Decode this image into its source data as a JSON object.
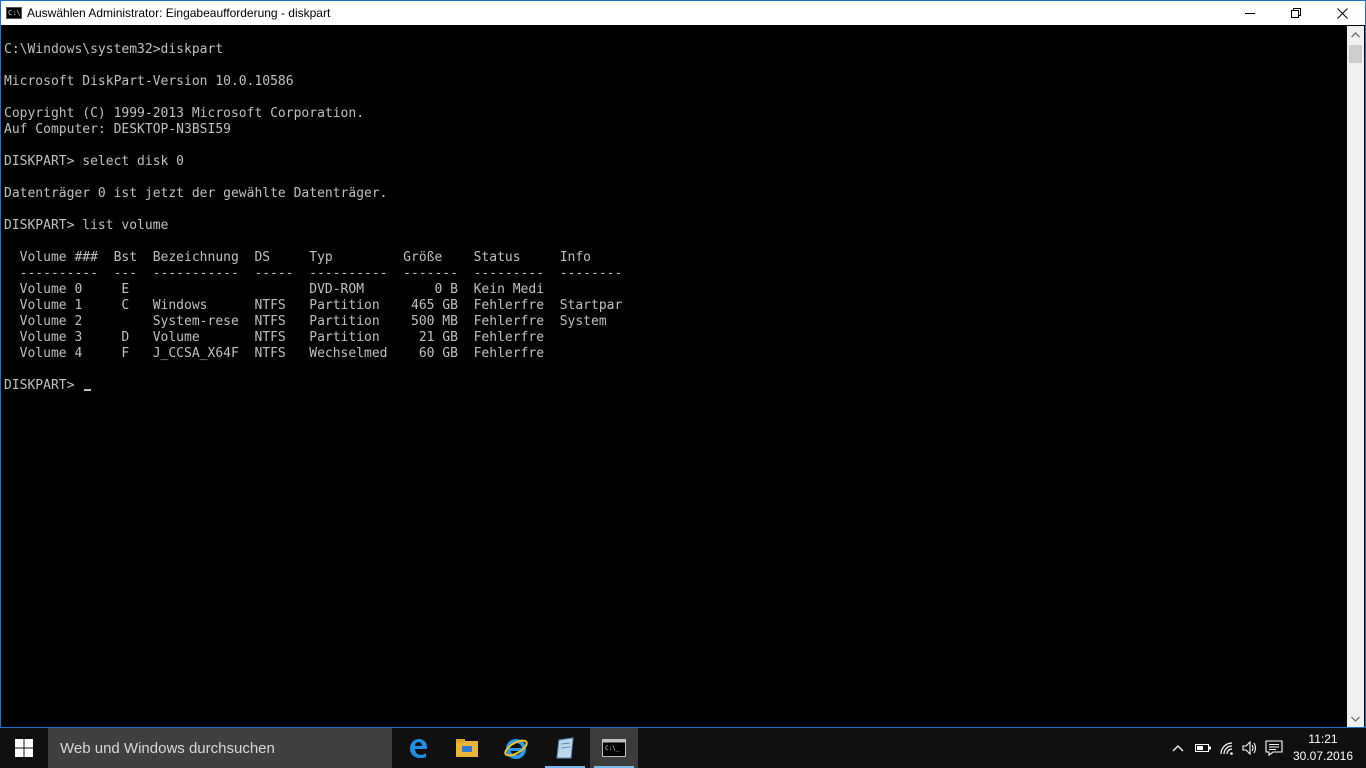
{
  "window": {
    "title": "Auswählen Administrator: Eingabeaufforderung - diskpart"
  },
  "console": {
    "lines": [
      "C:\\Windows\\system32>diskpart",
      "",
      "Microsoft DiskPart-Version 10.0.10586",
      "",
      "Copyright (C) 1999-2013 Microsoft Corporation.",
      "Auf Computer: DESKTOP-N3BSI59",
      "",
      "DISKPART> select disk 0",
      "",
      "Datenträger 0 ist jetzt der gewählte Datenträger.",
      "",
      "DISKPART> list volume",
      "",
      "  Volume ###  Bst  Bezeichnung  DS     Typ         Größe    Status     Info",
      "  ----------  ---  -----------  -----  ----------  -------  ---------  --------",
      "  Volume 0     E                       DVD-ROM         0 B  Kein Medi",
      "  Volume 1     C   Windows      NTFS   Partition    465 GB  Fehlerfre  Startpar",
      "  Volume 2         System-rese  NTFS   Partition    500 MB  Fehlerfre  System",
      "  Volume 3     D   Volume       NTFS   Partition     21 GB  Fehlerfre",
      "  Volume 4     F   J_CCSA_X64F  NTFS   Wechselmed    60 GB  Fehlerfre",
      "",
      "DISKPART> "
    ]
  },
  "taskbar": {
    "search_placeholder": "Web und Windows durchsuchen",
    "apps": [
      "edge-icon",
      "file-explorer-icon",
      "internet-explorer-icon",
      "notepad-icon",
      "command-prompt-icon"
    ],
    "clock_time": "11:21",
    "clock_date": "30.07.2016"
  },
  "colors": {
    "console_bg": "#000000",
    "console_text": "#c0c0c0",
    "taskbar_bg": "#101010",
    "accent": "#1a73c9"
  }
}
